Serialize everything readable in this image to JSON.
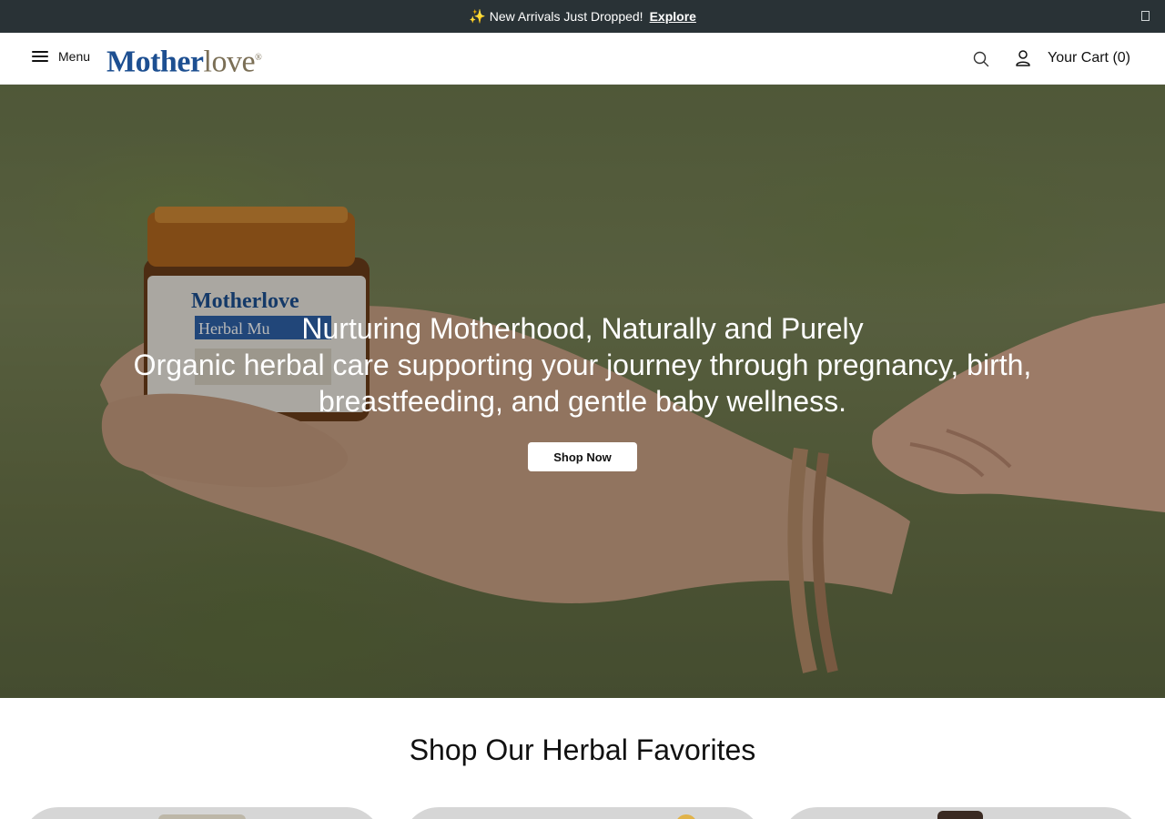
{
  "announcement": {
    "icon": "sparkles-icon",
    "text": "New Arrivals Just Dropped!",
    "link": "Explore"
  },
  "header": {
    "menu_label": "Menu",
    "logo": {
      "part1": "Mother",
      "part2": "love",
      "mark": "®"
    },
    "cart_label": "Your Cart (0)"
  },
  "hero": {
    "title": "Nurturing Motherhood, Naturally and Purely",
    "subtitle": "Organic herbal care supporting your journey through pregnancy, birth, breastfeeding, and gentle baby wellness.",
    "cta": "Shop Now",
    "jar_label": {
      "brand": "Motherlove",
      "product": "Herbal Mu"
    }
  },
  "favorites": {
    "title": "Shop Our Herbal Favorites"
  },
  "colors": {
    "announcement_bg": "#293236",
    "logo_blue": "#1d4f91",
    "logo_olive": "#7b6f56"
  }
}
